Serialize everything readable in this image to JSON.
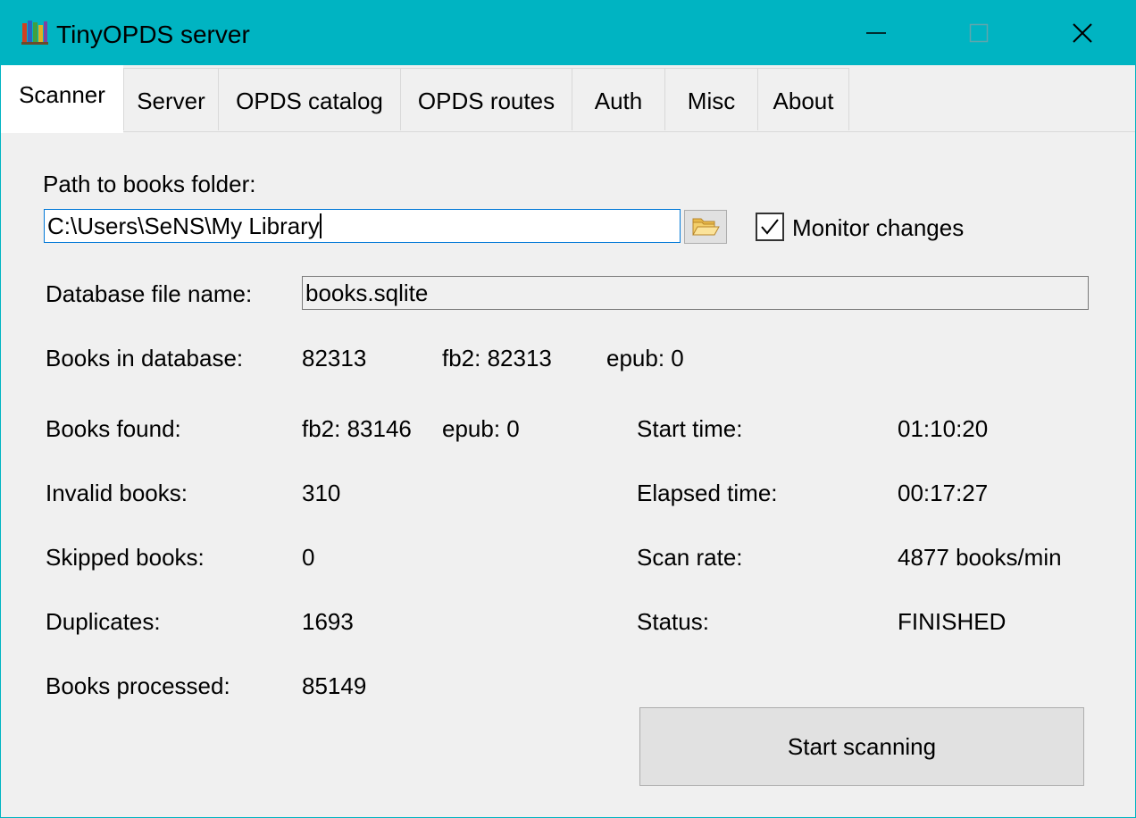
{
  "window": {
    "title": "TinyOPDS server"
  },
  "tabs": [
    {
      "label": "Scanner",
      "active": true
    },
    {
      "label": "Server",
      "active": false
    },
    {
      "label": "OPDS catalog",
      "active": false
    },
    {
      "label": "OPDS routes",
      "active": false
    },
    {
      "label": "Auth",
      "active": false
    },
    {
      "label": "Misc",
      "active": false
    },
    {
      "label": "About",
      "active": false
    }
  ],
  "scanner": {
    "path_label": "Path to books folder:",
    "path_value": "C:\\Users\\SeNS\\My Library",
    "folder_icon": "folder-open-icon",
    "monitor_label": "Monitor changes",
    "monitor_checked": true,
    "db_label": "Database file name:",
    "db_value": "books.sqlite",
    "books_in_db_label": "Books in database:",
    "books_in_db_total": "82313",
    "books_in_db_fb2": "fb2: 82313",
    "books_in_db_epub": "epub: 0",
    "stats_left": [
      {
        "label": "Books found:",
        "value": "fb2: 83146",
        "value2": "epub: 0"
      },
      {
        "label": "Invalid books:",
        "value": "310"
      },
      {
        "label": "Skipped books:",
        "value": "0"
      },
      {
        "label": "Duplicates:",
        "value": "1693"
      },
      {
        "label": "Books processed:",
        "value": "85149"
      }
    ],
    "stats_right": [
      {
        "label": "Start time:",
        "value": "01:10:20"
      },
      {
        "label": "Elapsed time:",
        "value": "00:17:27"
      },
      {
        "label": "Scan rate:",
        "value": "4877 books/min"
      },
      {
        "label": "Status:",
        "value": "FINISHED"
      }
    ],
    "start_button": "Start scanning"
  },
  "colors": {
    "titlebar": "#00b4c2",
    "body": "#f0f0f0",
    "focus_border": "#0078d7"
  }
}
